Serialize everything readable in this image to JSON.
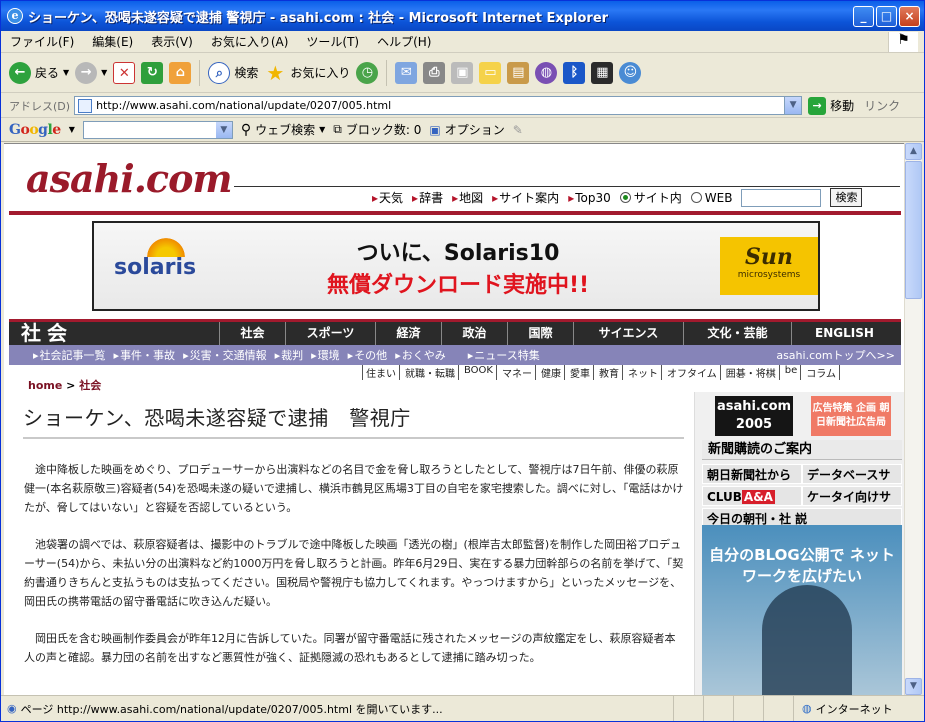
{
  "window": {
    "title": "ショーケン、恐喝未遂容疑で逮捕 警視庁 - asahi.com : 社会 - Microsoft Internet Explorer",
    "buttons": [
      "_",
      "□",
      "×"
    ]
  },
  "menubar": [
    "ファイル(F)",
    "編集(E)",
    "表示(V)",
    "お気に入り(A)",
    "ツール(T)",
    "ヘルプ(H)"
  ],
  "toolbar": {
    "back": "戻る",
    "search": "検索",
    "favorites": "お気に入り"
  },
  "address": {
    "label": "アドレス(D)",
    "url": "http://www.asahi.com/national/update/0207/005.html",
    "go": "移動",
    "links": "リンク"
  },
  "googlebar": {
    "logo": "Google",
    "websearch": "ウェブ検索",
    "popups": "ブロック数: 0",
    "options": "オプション"
  },
  "site": {
    "logo": "asahi.com",
    "topnav": [
      "天気",
      "辞書",
      "地図",
      "サイト案内",
      "Top30"
    ],
    "radio_site": "サイト内",
    "radio_web": "WEB",
    "search_btn": "検索",
    "banner": {
      "brand": "solaris",
      "line1": "ついに、Solaris10",
      "line2": "無償ダウンロード実施中!!",
      "sun": "Sun",
      "sun_sub": "microsystems"
    },
    "section": "社会",
    "categories": [
      "社会",
      "スポーツ",
      "経済",
      "政治",
      "国際",
      "サイエンス",
      "文化・芸能",
      "ENGLISH"
    ],
    "subnav": [
      "社会記事一覧",
      "事件・事故",
      "災害・交通情報",
      "裁判",
      "環境",
      "その他",
      "おくやみ",
      "ニュース特集"
    ],
    "subnav_right": "asahi.comトップへ>>",
    "sitelinks": [
      "住まい",
      "就職・転職",
      "BOOK",
      "マネー",
      "健康",
      "愛車",
      "教育",
      "ネット",
      "オフタイム",
      "囲碁・将棋",
      "be",
      "コラム"
    ],
    "crumb_home": "home",
    "crumb_sep": ">",
    "crumb_section": "社会",
    "headline": "ショーケン、恐喝未遂容疑で逮捕　警視庁",
    "paragraphs": [
      "途中降板した映画をめぐり、プロデューサーから出演料などの名目で金を脅し取ろうとしたとして、警視庁は7日午前、俳優の萩原健一(本名萩原敬三)容疑者(54)を恐喝未遂の疑いで逮捕し、横浜市鶴見区馬場3丁目の自宅を家宅捜索した。調べに対し、「電話はかけたが、脅してはいない」と容疑を否認しているという。",
      "池袋署の調べでは、萩原容疑者は、撮影中のトラブルで途中降板した映画「透光の樹」(根岸吉太郎監督)を制作した岡田裕プロデューサー(54)から、未払い分の出演料など約1000万円を脅し取ろうと計画。昨年6月29日、実在する暴力団幹部らの名前を挙げて、「契約書通りきちんと支払うものは支払ってください。国税局や警視庁も協力してくれます。やっつけますから」といったメッセージを、岡田氏の携帯電話の留守番電話に吹き込んだ疑い。",
      "岡田氏を含む映画制作委員会が昨年12月に告訴していた。同署が留守番電話に残されたメッセージの声紋鑑定をし、萩原容疑者本人の声と確認。暴力団の名前を出すなど悪質性が強く、証拠隠滅の恐れもあるとして逮捕に踏み切った。"
    ],
    "sidebar": {
      "s2005": "asahi.com 2005",
      "ad": "広告特集 企画 朝日新聞社広告局",
      "news": "新聞購読のご案内",
      "row1": [
        "朝日新聞社から",
        "データベースサービス"
      ],
      "club": "CLUB",
      "club2": "A&A",
      "mobile": "ケータイ向けサービス",
      "today": "今日の朝刊・社 説",
      "blog": "自分のBLOG公開で ネットワークを広げたい"
    }
  },
  "status": {
    "message": "ページ http://www.asahi.com/national/update/0207/005.html を開いています...",
    "zone": "インターネット"
  }
}
